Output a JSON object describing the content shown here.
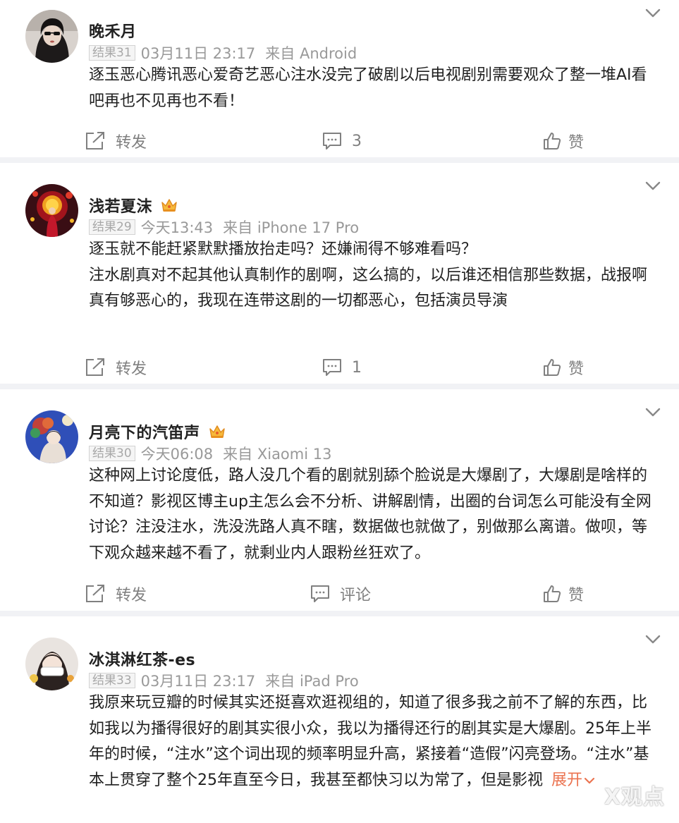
{
  "comments": [
    {
      "username": "晚禾月",
      "rank": "结果31",
      "time": "03月11日 23:17",
      "source": "来自 Android",
      "has_crown": false,
      "lines": [
        "逐玉恶心腾讯恶心爱奇艺恶心注水没完了破剧以后电视剧别需要观众了整一堆AI看吧再也不见再也不看！"
      ],
      "forward_label": "转发",
      "comment_label": "3",
      "like_label": "赞"
    },
    {
      "username": "浅若夏沫",
      "rank": "结果29",
      "time": "今天13:43",
      "source": "来自 iPhone 17 Pro",
      "has_crown": true,
      "lines": [
        "逐玉就不能赶紧默默播放抬走吗？还嫌闹得不够难看吗？",
        "注水剧真对不起其他认真制作的剧啊，这么搞的，以后谁还相信那些数据，战报啊",
        "真有够恶心的，我现在连带这剧的一切都恶心，包括演员导演"
      ],
      "forward_label": "转发",
      "comment_label": "1",
      "like_label": "赞"
    },
    {
      "username": "月亮下的汽笛声",
      "rank": "结果30",
      "time": "今天06:08",
      "source": "来自 Xiaomi 13",
      "has_crown": true,
      "lines": [
        "这种网上讨论度低，路人没几个看的剧就别舔个脸说是大爆剧了，大爆剧是啥样的不知道？影视区博主up主怎么会不分析、讲解剧情，出圈的台词怎么可能没有全网讨论？注没注水，洗没洗路人真不瞎，数据做也就做了，别做那么离谱。做呗，等下观众越来越不看了，就剩业内人跟粉丝狂欢了。"
      ],
      "forward_label": "转发",
      "comment_label": "评论",
      "like_label": "赞"
    },
    {
      "username": "冰淇淋红茶-es",
      "rank": "结果33",
      "time": "03月11日 23:17",
      "source": "来自 iPad Pro",
      "has_crown": false,
      "lines": [
        "我原来玩豆瓣的时候其实还挺喜欢逛视组的，知道了很多我之前不了解的东西，比如我以为播得很好的剧其实很小众，我以为播得还行的剧其实是大爆剧。25年上半年的时候，“注水”这个词出现的频率明显升高，紧接着“造假”闪亮登场。“注水”基本上贯穿了整个25年直至今日，我甚至都快习以为常了，但是影视"
      ],
      "expand_label": "展开"
    }
  ],
  "watermark": "X观点",
  "icons": {
    "collapse": "chevron-down-icon",
    "forward": "forward-icon",
    "comment": "comment-icon",
    "like": "thumbs-up-icon",
    "crown": "crown-icon"
  },
  "colors": {
    "accent": "#eb7350",
    "meta_gray": "#999999",
    "divider": "#f1f2f5"
  }
}
